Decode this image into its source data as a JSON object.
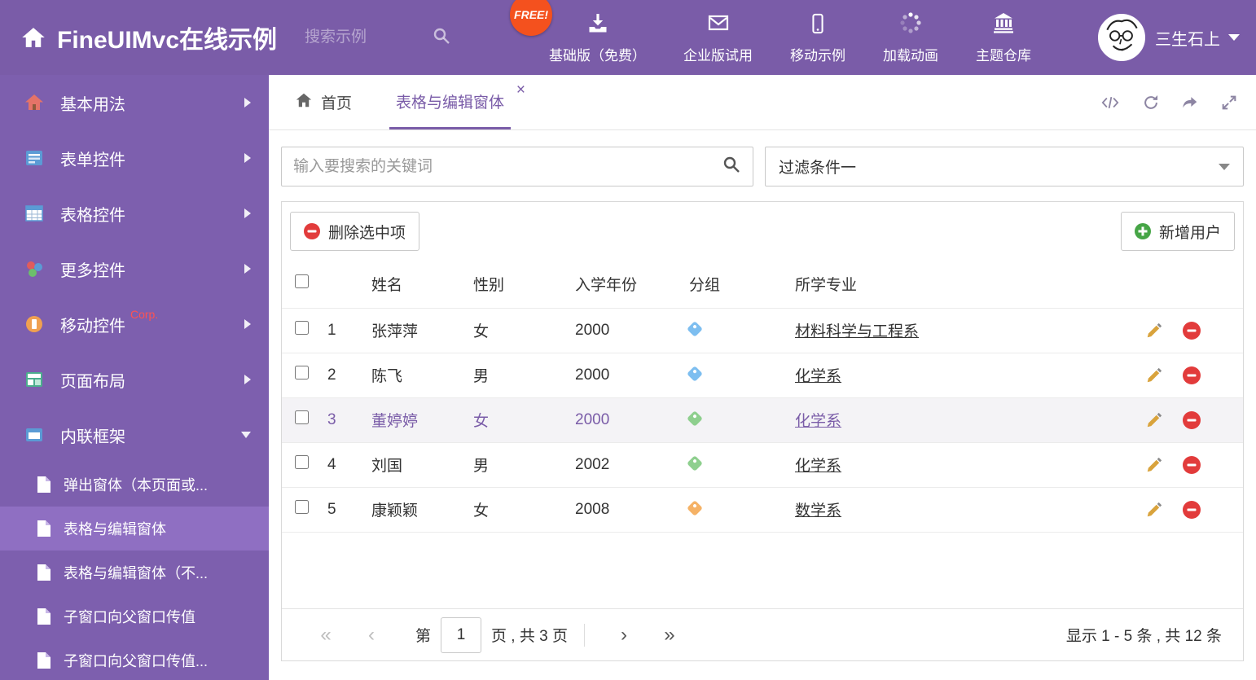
{
  "colors": {
    "purple": "#7a5ca8",
    "sidebar_purple": "#7d5fae",
    "active_item_purple": "#8f6fc2",
    "free_badge": "#f4511e",
    "danger_red": "#e23b3b",
    "success_green": "#46a546"
  },
  "header": {
    "title": "FineUIMvc在线示例",
    "search_placeholder": "搜索示例",
    "free_badge": "FREE!",
    "menu": [
      {
        "label": "基础版（免费）",
        "icon": "download-icon"
      },
      {
        "label": "企业版试用",
        "icon": "mail-icon"
      },
      {
        "label": "移动示例",
        "icon": "mobile-icon"
      },
      {
        "label": "加载动画",
        "icon": "spinner-icon"
      },
      {
        "label": "主题仓库",
        "icon": "bank-icon"
      }
    ],
    "user_name": "三生石上"
  },
  "sidebar": {
    "items": [
      {
        "label": "基本用法",
        "icon": "home-icon"
      },
      {
        "label": "表单控件",
        "icon": "form-icon"
      },
      {
        "label": "表格控件",
        "icon": "table-icon"
      },
      {
        "label": "更多控件",
        "icon": "widgets-icon"
      },
      {
        "label": "移动控件",
        "icon": "mobile-icon",
        "badge": "Corp."
      },
      {
        "label": "页面布局",
        "icon": "layout-icon"
      },
      {
        "label": "内联框架",
        "icon": "iframe-icon",
        "expanded": true
      }
    ],
    "subitems": [
      {
        "label": "弹出窗体（本页面或...",
        "active": false
      },
      {
        "label": "表格与编辑窗体",
        "active": true
      },
      {
        "label": "表格与编辑窗体（不...",
        "active": false
      },
      {
        "label": "子窗口向父窗口传值",
        "active": false
      },
      {
        "label": "子窗口向父窗口传值...",
        "active": false
      }
    ]
  },
  "main": {
    "tabs": [
      {
        "label": "首页",
        "active": false
      },
      {
        "label": "表格与编辑窗体",
        "active": true
      }
    ],
    "glyphs": {
      "close": "×"
    },
    "filter": {
      "search_placeholder": "输入要搜索的关键词",
      "dropdown_value": "过滤条件一"
    },
    "toolbar": {
      "delete_label": "删除选中项",
      "add_label": "新增用户"
    },
    "table": {
      "columns": [
        "姓名",
        "性别",
        "入学年份",
        "分组",
        "所学专业"
      ],
      "rows": [
        {
          "num": "1",
          "name": "张萍萍",
          "gender": "女",
          "year": "2000",
          "tag_color": "#7dbef0",
          "major": "材料科学与工程系",
          "selected": false
        },
        {
          "num": "2",
          "name": "陈飞",
          "gender": "男",
          "year": "2000",
          "tag_color": "#7dbef0",
          "major": "化学系",
          "selected": false
        },
        {
          "num": "3",
          "name": "董婷婷",
          "gender": "女",
          "year": "2000",
          "tag_color": "#8ecf8e",
          "major": "化学系",
          "selected": true
        },
        {
          "num": "4",
          "name": "刘国",
          "gender": "男",
          "year": "2002",
          "tag_color": "#8ecf8e",
          "major": "化学系",
          "selected": false
        },
        {
          "num": "5",
          "name": "康颖颖",
          "gender": "女",
          "year": "2008",
          "tag_color": "#f5b266",
          "major": "数学系",
          "selected": false
        }
      ]
    },
    "pagination": {
      "first": "«",
      "prev": "‹",
      "next": "›",
      "last": "»",
      "prefix": "第",
      "current_page": "1",
      "suffix": "页 , 共 3 页",
      "summary": "显示 1 - 5 条 , 共 12 条"
    }
  }
}
